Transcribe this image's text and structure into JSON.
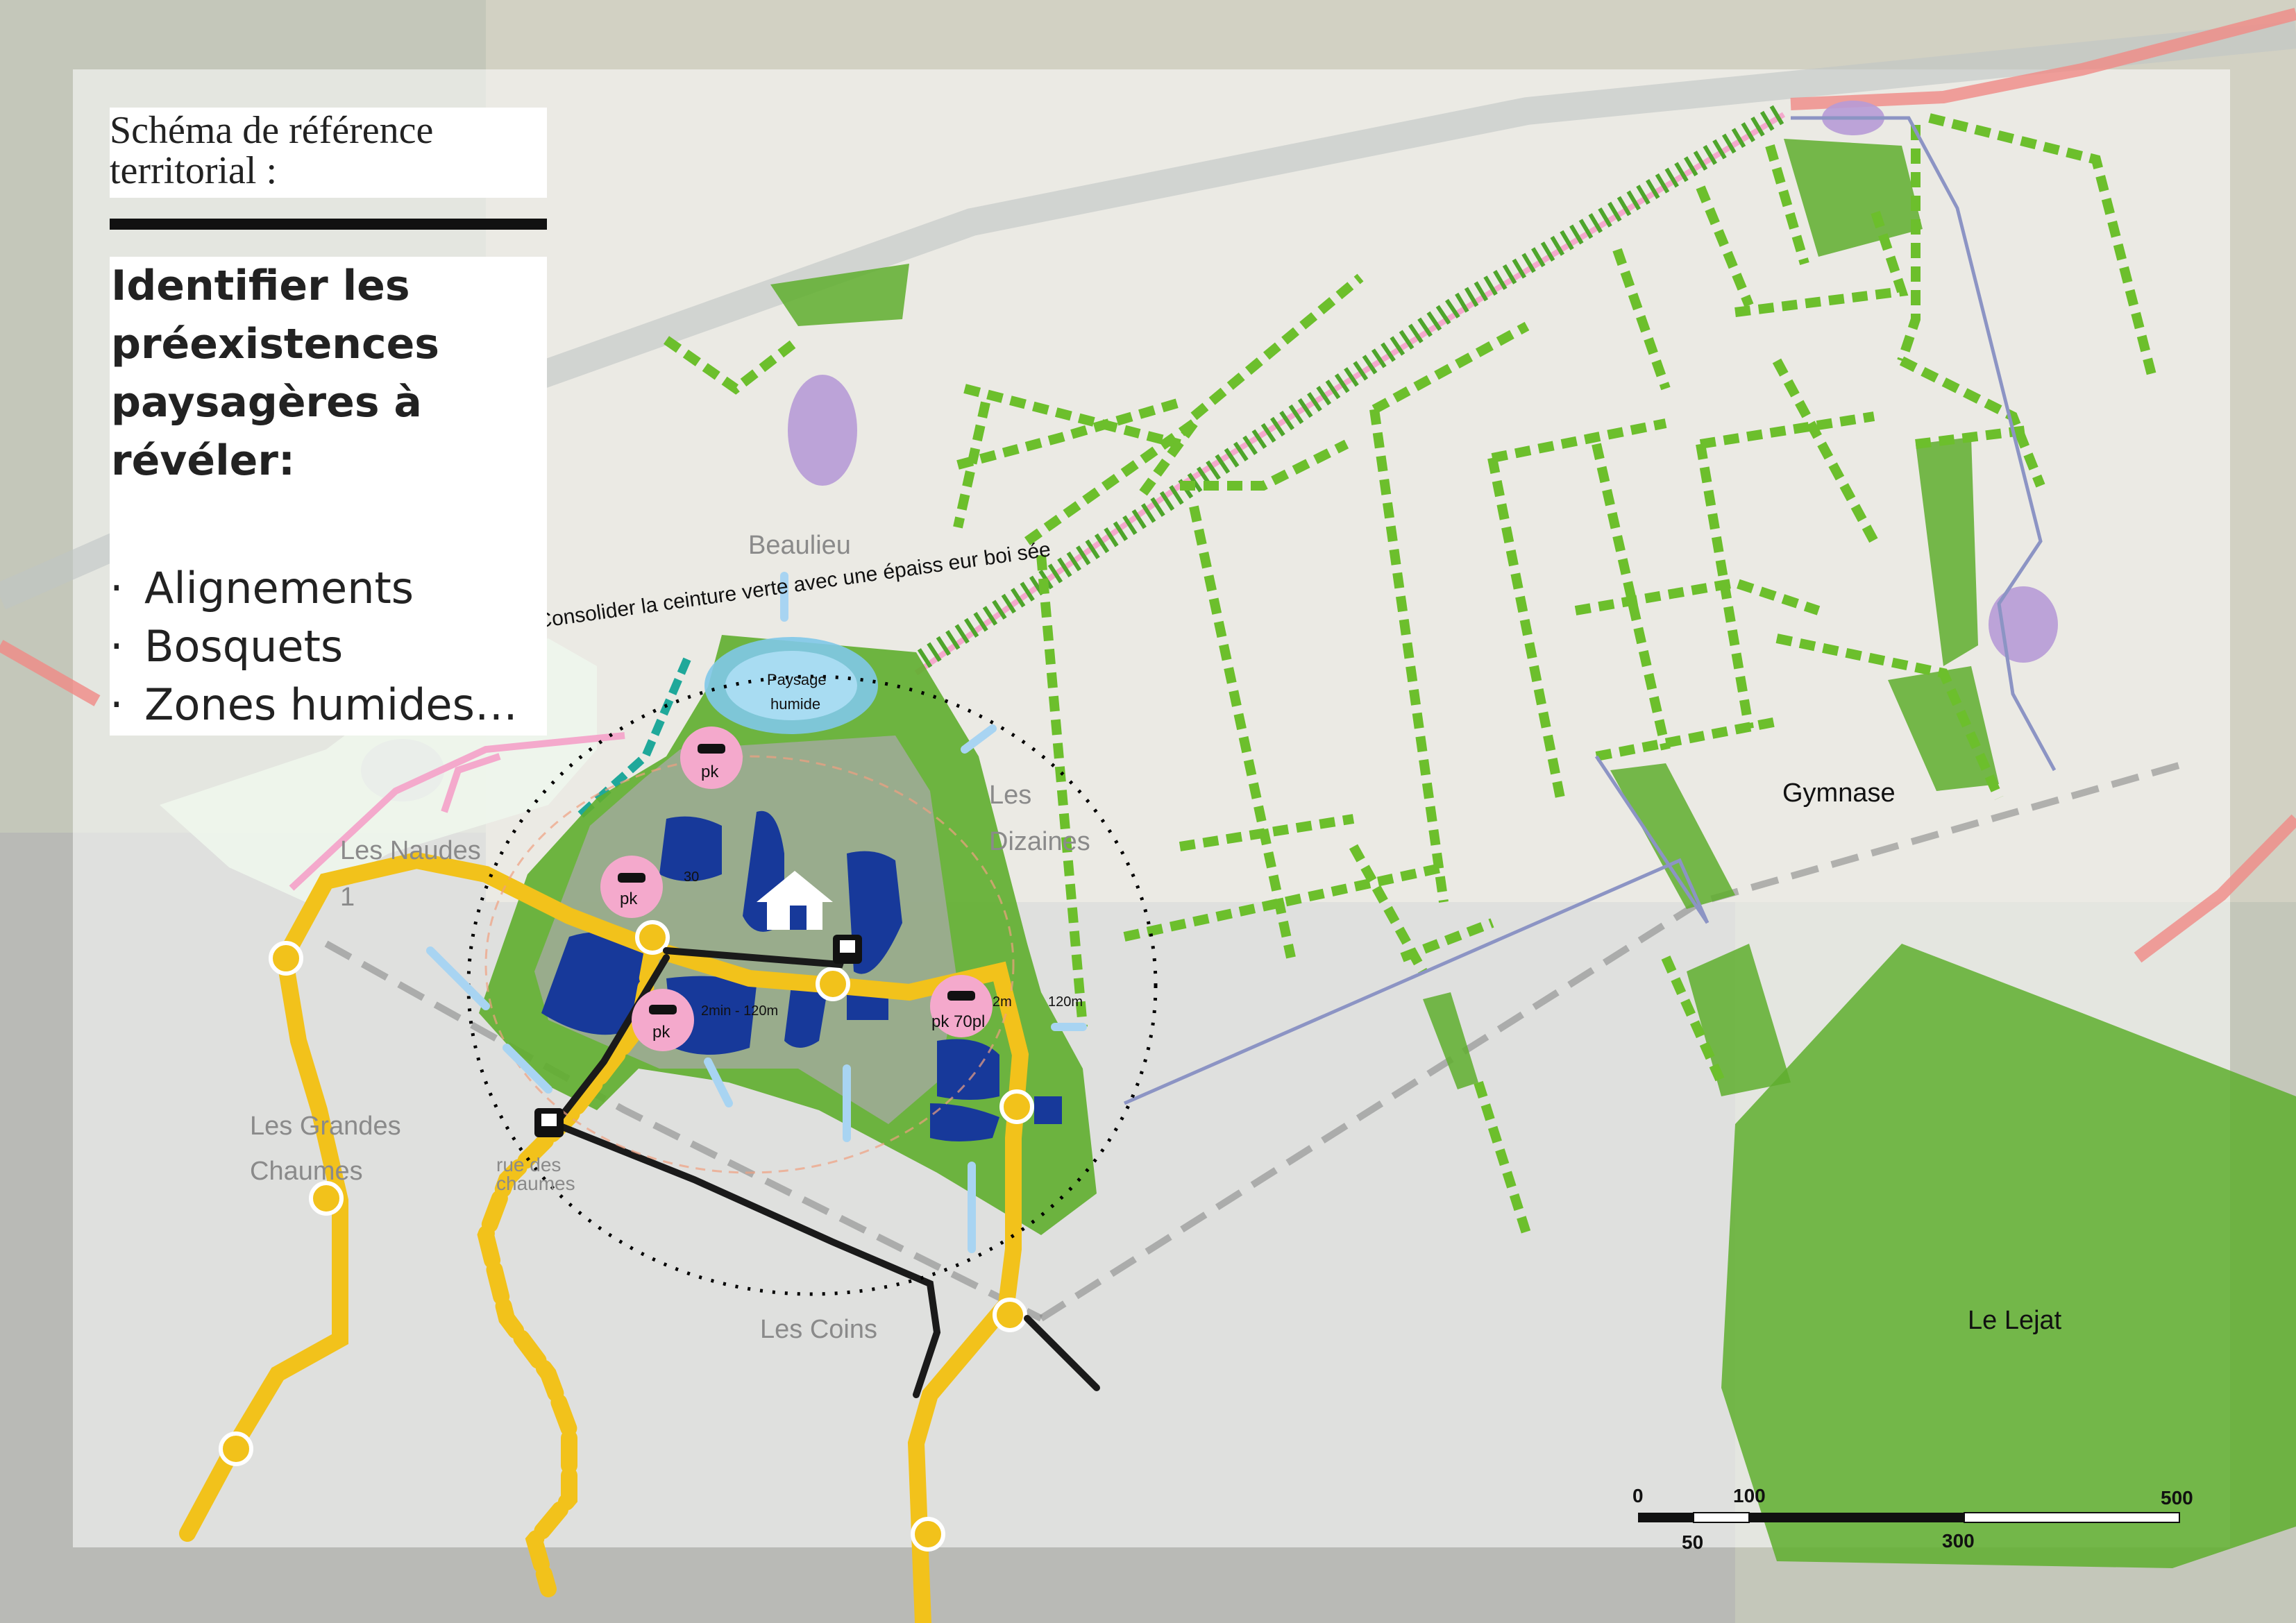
{
  "panel": {
    "title_line1": "Schéma de référence",
    "title_line2": "territorial :",
    "subtitle_lines": [
      "Identifier les",
      "préexistences",
      "paysagères à",
      "révéler:"
    ],
    "bullets": [
      "Alignements",
      "Bosquets",
      "Zones humides…"
    ],
    "bullet_mark": "·"
  },
  "labels": {
    "beaulieu": "Beaulieu",
    "les_dizaines_1": "Les",
    "les_dizaines_2": "Dizaines",
    "gymnase": "Gymnase",
    "le_lejat": "Le Lejat",
    "les_coins": "Les Coins",
    "les_grandes_1": "Les Grandes",
    "les_grandes_2": "Chaumes",
    "les_nauds_1": "Les Naudes",
    "les_nauds_2": "1",
    "rue_1": "rue des",
    "rue_2": "chaumes",
    "paysage_1": "Paysage",
    "paysage_2": "humide",
    "ceinture": "Consolider la ceinture verte   avec   une  épaiss eur boi sée",
    "pk": "pk",
    "pk70": "pk 70pl",
    "time_1": "2min - 120m",
    "time_2": "2m",
    "time_3": "120m",
    "time_4": "30"
  },
  "scale": {
    "ticks_top": [
      "0",
      "100",
      "500"
    ],
    "ticks_bottom": [
      "50",
      "300"
    ]
  },
  "colors": {
    "green": "#5fae2e",
    "green_dash": "#6cbf2c",
    "yellow": "#f2c21b",
    "pink": "#f4a9cc",
    "blue": "#17399a",
    "lilac": "#b79bd6",
    "teal": "#1fa89a",
    "red_road": "#f08a86"
  }
}
